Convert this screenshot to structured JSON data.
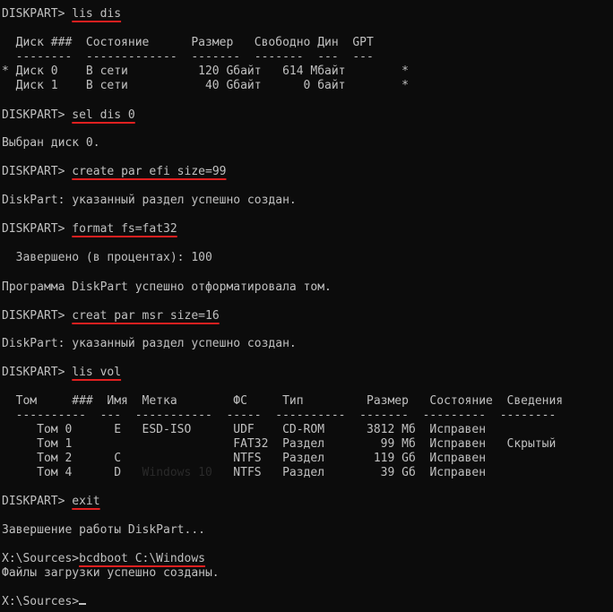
{
  "console": {
    "prompt_diskpart": "DISKPART> ",
    "cmd_lis_dis": "lis dis",
    "disk_header": "  Диск ###  Состояние      Размер   Свободно Дин  GPT",
    "disk_sep": "  --------  -------------  -------  -------  ---  ---",
    "disk_row0": "* Диск 0    В сети          120 Gбайт   614 Mбайт        *",
    "disk_row1": "  Диск 1    В сети           40 Gбайт      0 байт        *",
    "cmd_sel_dis": "sel dis 0",
    "msg_selected": "Выбран диск 0.",
    "cmd_create_efi": "create par efi size=99",
    "msg_created_1": "DiskPart: указанный раздел успешно создан.",
    "cmd_format": "format fs=fat32",
    "msg_progress": "  Завершено (в процентах): 100",
    "msg_formatted": "Программа DiskPart успешно отформатировала том.",
    "cmd_create_msr": "creat par msr size=16",
    "msg_created_2": "DiskPart: указанный раздел успешно создан.",
    "cmd_lis_vol": "lis vol",
    "vol_header": "  Том     ###  Имя  Метка        ФС     Тип         Размер   Состояние  Сведения",
    "vol_sep": "  ----------  ---  -----------  -----  ----------  -------  ---------  --------",
    "vol_row0": "     Том 0      E   ESD-ISO      UDF    CD-ROM      3812 Мб  Исправен",
    "vol_row1": "     Том 1                       FAT32  Раздел        99 Мб  Исправен   Скрытый",
    "vol_row2": "     Том 2      C                NTFS   Раздел       119 Gб  Исправен",
    "vol_row3_a": "     Том 4      D   ",
    "vol_row3_ghost": "Windows 10",
    "vol_row3_b": "   NTFS   Раздел        39 Gб  Исправен",
    "cmd_exit": "exit",
    "msg_exit": "Завершение работы DiskPart...",
    "prompt_sources": "X:\\Sources>",
    "cmd_bcdboot": "bcdboot C:\\Windows",
    "msg_boot": "Файлы загрузки успешно созданы.",
    "prompt_final": "X:\\Sources>"
  }
}
